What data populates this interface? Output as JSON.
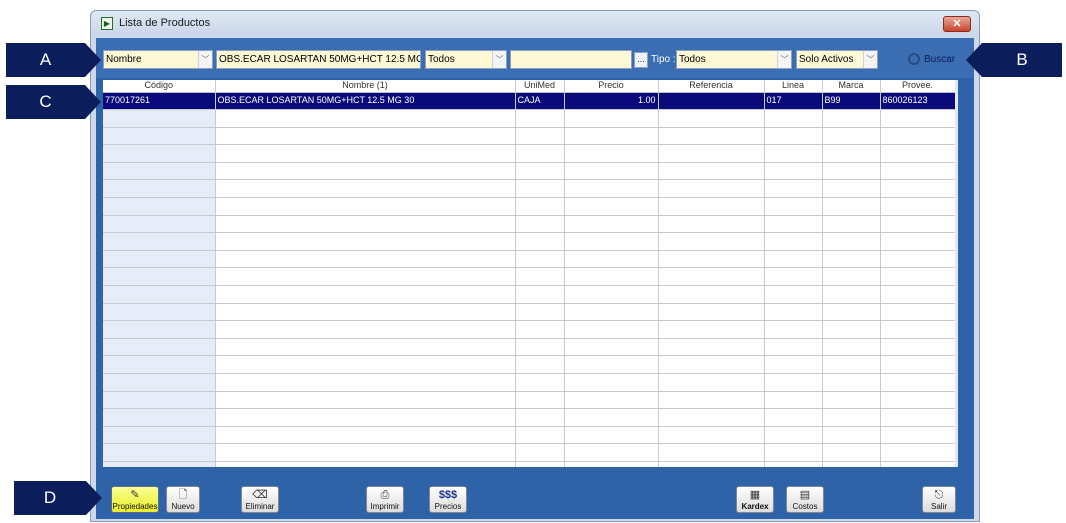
{
  "window": {
    "title": "Lista de Productos",
    "close_glyph": "✕"
  },
  "filters": {
    "campo": "Nombre",
    "search_value": "OBS.ECAR LOSARTAN 50MG+HCT 12.5 MG 30",
    "todos": "Todos",
    "extra_value": "",
    "ellipsis": "...",
    "tipo_label": "Tipo :",
    "tipo": "Todos",
    "estado": "Solo Activos",
    "buscar_label": "Buscar"
  },
  "callouts": {
    "a": "A",
    "b": "B",
    "c": "C",
    "d": "D"
  },
  "table": {
    "headers": [
      "Código",
      "Nombre (1)",
      "UniMed",
      "Precio",
      "Referencia",
      "Linea",
      "Marca",
      "Provee."
    ],
    "rows": [
      [
        "770017261",
        "OBS.ECAR LOSARTAN 50MG+HCT 12.5 MG 30",
        "CAJA",
        "1.00",
        "",
        "017",
        "B99",
        "860026123"
      ]
    ],
    "empty_rows": 21
  },
  "toolbar": {
    "propiedades": "Propiedades",
    "nuevo": "Nuevo",
    "eliminar": "Eliminar",
    "imprimir": "Imprimir",
    "precios": "Precios",
    "precios_icon_text": "$$$",
    "kardex": "Kardex",
    "costos": "Costos",
    "salir": "Salir"
  },
  "colors": {
    "accent": "#2f63a8",
    "selected_row": "#0a0a7a",
    "callout": "#0b1e5b",
    "input_bg": "#fff8d6"
  }
}
